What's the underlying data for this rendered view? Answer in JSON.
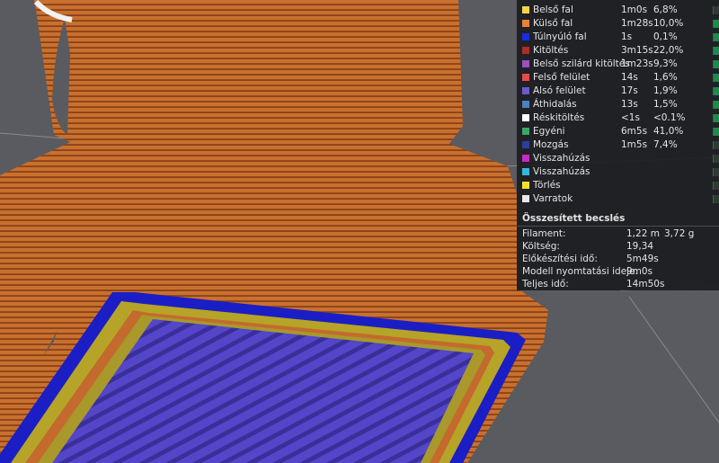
{
  "legend": {
    "items": [
      {
        "name": "Belső fal",
        "time": "1m0s",
        "percent": "6,8%",
        "color": "#f2d548",
        "checked": false
      },
      {
        "name": "Külső fal",
        "time": "1m28s",
        "percent": "10,0%",
        "color": "#e8823a",
        "checked": true
      },
      {
        "name": "Túlnyúló fal",
        "time": "1s",
        "percent": "0,1%",
        "color": "#1a2de0",
        "checked": true
      },
      {
        "name": "Kitöltés",
        "time": "3m15s",
        "percent": "22,0%",
        "color": "#b02a2a",
        "checked": true
      },
      {
        "name": "Belső szilárd kitöltés",
        "time": "1m23s",
        "percent": "9,3%",
        "color": "#9a4fc4",
        "checked": true
      },
      {
        "name": "Felső felület",
        "time": "14s",
        "percent": "1,6%",
        "color": "#e84a4a",
        "checked": true
      },
      {
        "name": "Alsó felület",
        "time": "17s",
        "percent": "1,9%",
        "color": "#6a5ad0",
        "checked": true
      },
      {
        "name": "Áthidalás",
        "time": "13s",
        "percent": "1,5%",
        "color": "#4f7fc0",
        "checked": true
      },
      {
        "name": "Réskitöltés",
        "time": "<1s",
        "percent": "<0.1%",
        "color": "#ffffff",
        "checked": true
      },
      {
        "name": "Egyéni",
        "time": "6m5s",
        "percent": "41,0%",
        "color": "#3aa66a",
        "checked": true
      },
      {
        "name": "Mozgás",
        "time": "1m5s",
        "percent": "7,4%",
        "color": "#2f3c9a",
        "checked": false
      },
      {
        "name": "Visszahúzás",
        "time": "",
        "percent": "",
        "color": "#c42ac4",
        "checked": false
      },
      {
        "name": "Visszahúzás",
        "time": "",
        "percent": "",
        "color": "#35b8d8",
        "checked": false
      },
      {
        "name": "Törlés",
        "time": "",
        "percent": "",
        "color": "#f0e02a",
        "checked": false
      },
      {
        "name": "Varratok",
        "time": "",
        "percent": "",
        "color": "#e8e8e8",
        "checked": false
      }
    ]
  },
  "summary": {
    "title": "Összesített becslés",
    "rows": [
      {
        "label": "Filament:",
        "value": "1,22 m",
        "value2": "3,72 g"
      },
      {
        "label": "Költség:",
        "value": "19,34",
        "value2": ""
      },
      {
        "label": "Előkészítési idő:",
        "value": "5m49s",
        "value2": ""
      },
      {
        "label": "Modell nyomtatási ideje:",
        "value": "9m0s",
        "value2": ""
      },
      {
        "label": "Teljes idő:",
        "value": "14m50s",
        "value2": ""
      }
    ]
  },
  "colors": {
    "background": "#5a5b60",
    "model_orange": "#c46a2e",
    "stripe_dark": "#8c4417",
    "top_surface_purple": "#4a3fc0",
    "wall_yellow": "#b7a62a",
    "overhang_blue": "#1518c0"
  }
}
